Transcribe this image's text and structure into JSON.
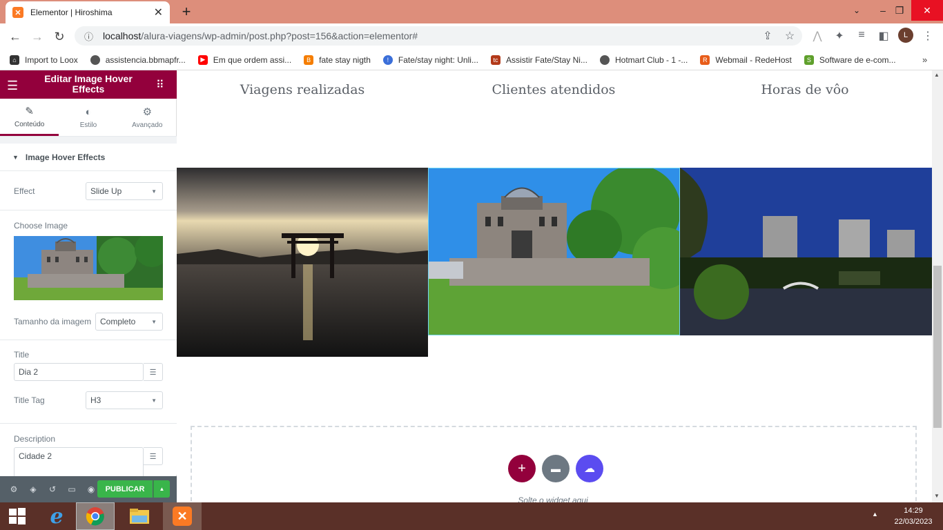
{
  "browser": {
    "tab_title": "Elementor | Hiroshima",
    "url_host": "localhost",
    "url_path": "/alura-viagens/wp-admin/post.php?post=156&action=elementor#",
    "avatar_letter": "L",
    "bookmarks": [
      {
        "label": "Import to Loox",
        "color": "#333333"
      },
      {
        "label": "assistencia.bbmapfr...",
        "color": "#555555"
      },
      {
        "label": "Em que ordem assi...",
        "color": "#ff0000"
      },
      {
        "label": "fate stay nigth",
        "color": "#f57d00"
      },
      {
        "label": "Fate/stay night: Unli...",
        "color": "#3b6fd9"
      },
      {
        "label": "Assistir Fate/Stay Ni...",
        "color": "#b33a1a"
      },
      {
        "label": "Hotmart Club - 1 -...",
        "color": "#555555"
      },
      {
        "label": "Webmail - RedeHost",
        "color": "#e85d1a"
      },
      {
        "label": "Software de e-com...",
        "color": "#5fa02c"
      }
    ]
  },
  "panel": {
    "title": "Editar Image Hover Effects",
    "tabs": [
      {
        "label": "Conteúdo",
        "icon": "pencil-icon"
      },
      {
        "label": "Estilo",
        "icon": "half-circle-icon"
      },
      {
        "label": "Avançado",
        "icon": "gear-icon"
      }
    ],
    "section_title": "Image Hover Effects",
    "effect_label": "Effect",
    "effect_value": "Slide Up",
    "choose_image_label": "Choose Image",
    "image_size_label": "Tamanho da imagem",
    "image_size_value": "Completo",
    "title_label": "Title",
    "title_value": "Dia 2",
    "title_tag_label": "Title Tag",
    "title_tag_value": "H3",
    "description_label": "Description",
    "description_value": "Cidade 2",
    "publish_label": "PUBLICAR"
  },
  "canvas": {
    "stats": [
      "Viagens realizadas",
      "Clientes atendidos",
      "Horas de vôo"
    ],
    "drop_text": "Solte o widget aqui"
  },
  "taskbar": {
    "time": "14:29",
    "date": "22/03/2023"
  },
  "colors": {
    "elementor_primary": "#93003c",
    "publish_green": "#39b54a",
    "tab_strip": "#dd8e7b",
    "taskbar": "#5a3028"
  }
}
